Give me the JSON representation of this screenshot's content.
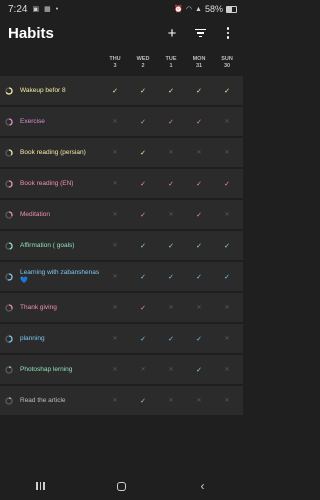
{
  "status_bar": {
    "time": "7:24",
    "battery_percent": "58%",
    "left_icons": [
      "photo-icon",
      "image-icon",
      "dot-icon"
    ],
    "right_icons": [
      "alarm-icon",
      "wifi-icon",
      "signal-icon"
    ]
  },
  "app_bar": {
    "title": "Habits",
    "actions": {
      "add": "+",
      "filter": "filter-icon",
      "more": "more-vert-icon"
    }
  },
  "days": [
    {
      "dow": "THU",
      "date": "3"
    },
    {
      "dow": "WED",
      "date": "2"
    },
    {
      "dow": "TUE",
      "date": "1"
    },
    {
      "dow": "MON",
      "date": "31"
    },
    {
      "dow": "SUN",
      "date": "30"
    }
  ],
  "habits": [
    {
      "name": "Wakeup befor 8",
      "color": "#f5eea4",
      "progress": 0.65,
      "marks": [
        "check",
        "check",
        "check",
        "check",
        "check"
      ]
    },
    {
      "name": "Exercise",
      "color": "#d98fd6",
      "progress": 0.45,
      "marks": [
        "cross",
        "check",
        "check",
        "check",
        "cross"
      ]
    },
    {
      "name": "Book reading (persian)",
      "color": "#f5eea4",
      "progress": 0.35,
      "marks": [
        "cross",
        "check",
        "cross",
        "cross",
        "cross"
      ]
    },
    {
      "name": "Book reading (EN)",
      "color": "#f08fb4",
      "progress": 0.5,
      "marks": [
        "cross",
        "check",
        "check",
        "check",
        "check"
      ]
    },
    {
      "name": "Meditation",
      "color": "#f08fb4",
      "progress": 0.3,
      "marks": [
        "cross",
        "check",
        "cross",
        "check",
        "cross"
      ]
    },
    {
      "name": "Affirmation ( goals)",
      "color": "#8fe0b8",
      "progress": 0.45,
      "marks": [
        "cross",
        "check",
        "check",
        "check",
        "check"
      ]
    },
    {
      "name": "Learning with zabanshenas💙",
      "color": "#7dc8f0",
      "progress": 0.55,
      "marks": [
        "cross",
        "check",
        "check",
        "check",
        "check"
      ]
    },
    {
      "name": "Thank giving",
      "color": "#f08fb4",
      "progress": 0.3,
      "marks": [
        "cross",
        "check",
        "cross",
        "cross",
        "cross"
      ]
    },
    {
      "name": "planning",
      "color": "#7dc8f0",
      "progress": 0.5,
      "marks": [
        "cross",
        "check",
        "check",
        "check",
        "cross"
      ]
    },
    {
      "name": "Photoshap lerning",
      "color": "#8fe0b8",
      "progress": 0.1,
      "marks": [
        "cross",
        "cross",
        "cross",
        "check",
        "cross"
      ]
    },
    {
      "name": "Read the article",
      "color": "#bdbdbd",
      "progress": 0.1,
      "marks": [
        "cross",
        "check",
        "cross",
        "cross",
        "cross"
      ]
    }
  ],
  "glyphs": {
    "check": "✓",
    "cross": "✕"
  },
  "nav_bar": [
    "recents-button",
    "home-button",
    "back-button"
  ]
}
